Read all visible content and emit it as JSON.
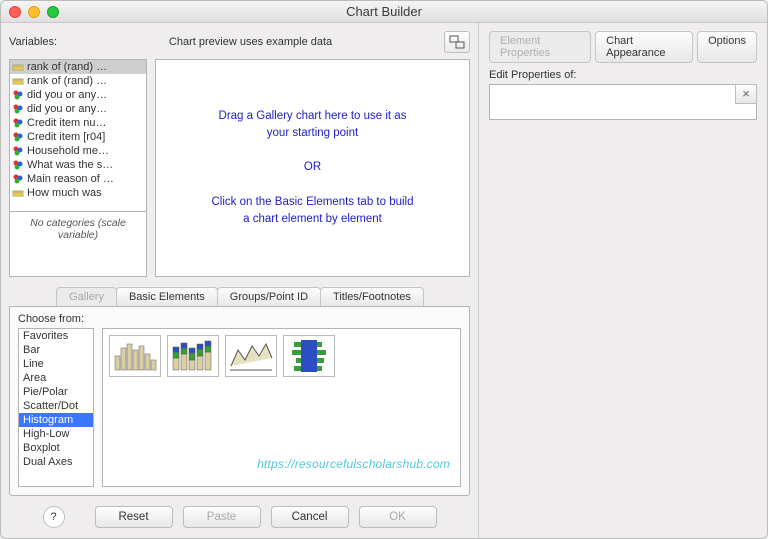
{
  "window": {
    "title": "Chart Builder"
  },
  "top": {
    "variables_label": "Variables:",
    "preview_text": "Chart preview uses example data"
  },
  "variables": {
    "items": [
      {
        "label": "rank of (rand) …",
        "type": "scale",
        "selected": true
      },
      {
        "label": "rank of (rand) …",
        "type": "scale"
      },
      {
        "label": "did you or any…",
        "type": "nominal"
      },
      {
        "label": "did you or any…",
        "type": "nominal"
      },
      {
        "label": "Credit item nu…",
        "type": "nominal"
      },
      {
        "label": "Credit item [r04]",
        "type": "nominal"
      },
      {
        "label": "Household me…",
        "type": "nominal"
      },
      {
        "label": "What was the s…",
        "type": "nominal"
      },
      {
        "label": "Main reason of …",
        "type": "nominal"
      },
      {
        "label": "How much was",
        "type": "scale"
      }
    ],
    "category_note": "No categories (scale variable)"
  },
  "canvas": {
    "line1": "Drag a Gallery chart here to use it as",
    "line2": "your starting point",
    "or": "OR",
    "line3": "Click on the Basic Elements tab to build",
    "line4": "a chart element by element"
  },
  "tabs": {
    "gallery": "Gallery",
    "basic": "Basic Elements",
    "groups": "Groups/Point ID",
    "titles": "Titles/Footnotes"
  },
  "gallery": {
    "choose_label": "Choose from:",
    "types": [
      "Favorites",
      "Bar",
      "Line",
      "Area",
      "Pie/Polar",
      "Scatter/Dot",
      "Histogram",
      "High-Low",
      "Boxplot",
      "Dual Axes"
    ],
    "selected": "Histogram",
    "watermark": "https://resourcefulscholarshub.com"
  },
  "buttons": {
    "help": "?",
    "reset": "Reset",
    "paste": "Paste",
    "cancel": "Cancel",
    "ok": "OK"
  },
  "right": {
    "tab_elem": "Element Properties",
    "tab_appear": "Chart Appearance",
    "tab_opt": "Options",
    "edit_label": "Edit Properties of:",
    "close": "×"
  }
}
